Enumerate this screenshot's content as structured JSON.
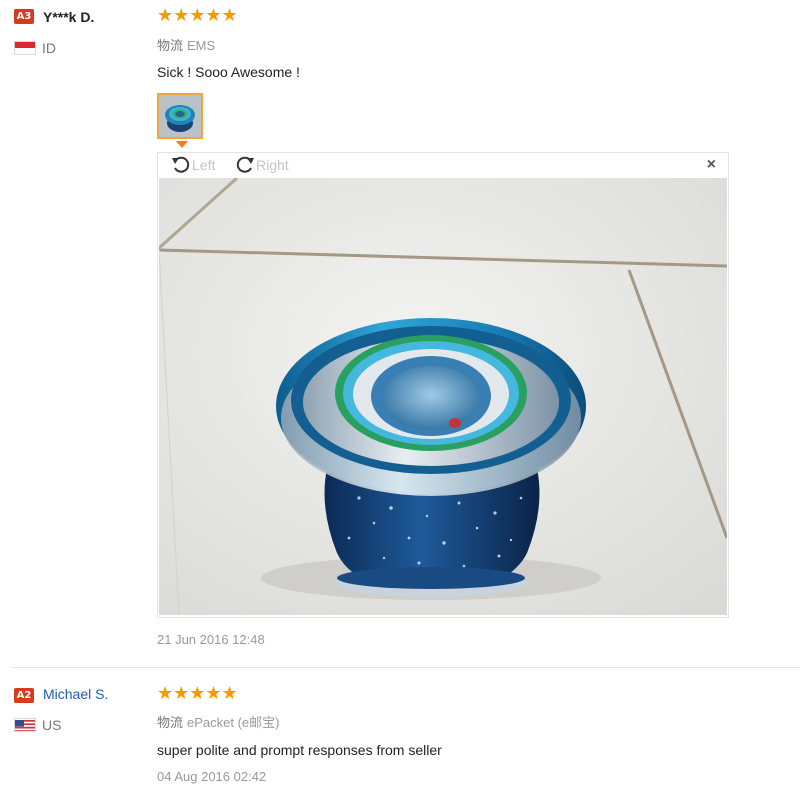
{
  "reviews": [
    {
      "badge": "A3",
      "badge_color": "#d93a1d",
      "username": "Y***k D.",
      "country": "ID",
      "flag": "indonesia-flag",
      "rating": "★★★★★",
      "shipping_label": "物流",
      "shipping_method": "EMS",
      "feedback": "Sick ! Sooo Awesome !",
      "photo_viewer": {
        "rotate_left": "Left",
        "rotate_right": "Right",
        "close": "×"
      },
      "date": "21 Jun 2016 12:48"
    },
    {
      "badge": "A2",
      "badge_color": "#d93a1d",
      "username": "Michael S.",
      "country": "US",
      "flag": "us-flag",
      "rating": "★★★★★",
      "shipping_label": "物流",
      "shipping_method": "ePacket (e邮宝)",
      "feedback": "super polite and prompt responses from seller",
      "date": "04 Aug 2016 02:42"
    }
  ],
  "colors": {
    "star": "#f79a00",
    "thumb_border": "#f4a23a",
    "username_link": "#1a5fb4"
  }
}
